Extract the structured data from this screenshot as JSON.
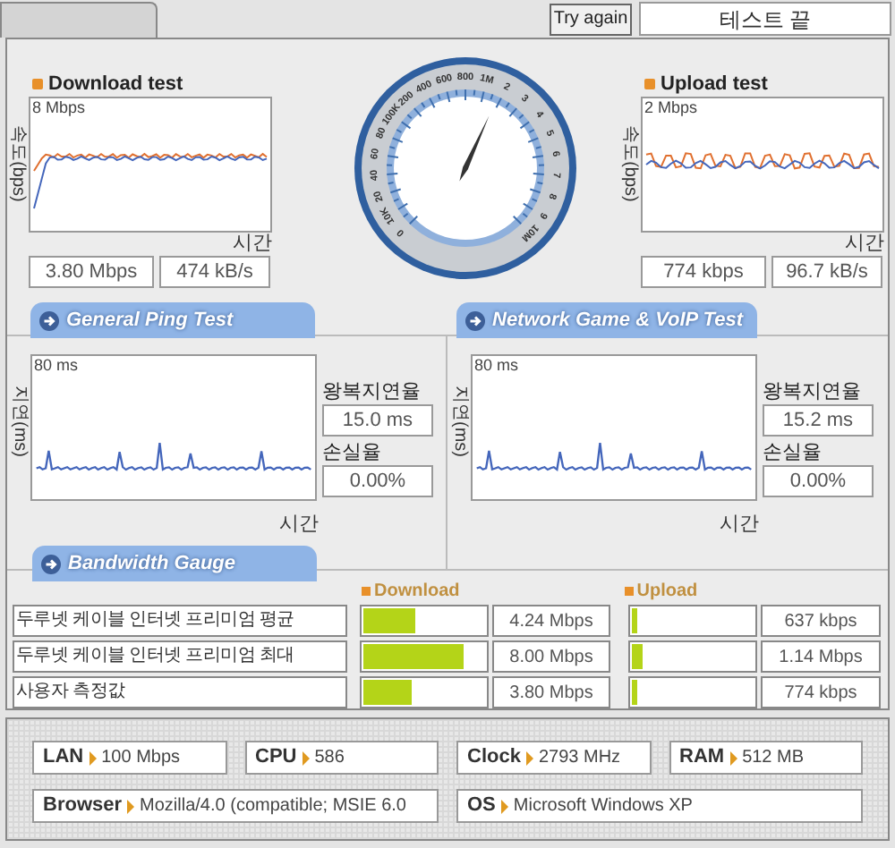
{
  "try_again_button": "Try again",
  "status_field": "테스트 끝",
  "download_test": {
    "title": "Download test",
    "scale_label": "8 Mbps",
    "ylabel": "속도(bps)",
    "xlabel": "시간",
    "rate": "3.80 Mbps",
    "throughput": "474 kB/s"
  },
  "gauge": {
    "labels": [
      "0",
      "10K",
      "20",
      "40",
      "60",
      "80",
      "100K",
      "200",
      "400",
      "600",
      "800",
      "1M",
      "2",
      "3",
      "4",
      "5",
      "6",
      "7",
      "8",
      "9",
      "10M"
    ],
    "level": 0.59
  },
  "upload_test": {
    "title": "Upload test",
    "scale_label": "2 Mbps",
    "ylabel": "속도(bps)",
    "xlabel": "시간",
    "rate": "774 kbps",
    "throughput": "96.7 kB/s"
  },
  "section_tabs": [
    "General Ping Test",
    "Network Game & VoIP Test"
  ],
  "ping_tests": [
    {
      "scale_label": "80 ms",
      "ylabel": "지연(ms)",
      "xlabel": "시간",
      "latency_label": "왕복지연율",
      "latency": "15.0 ms",
      "loss_label": "손실율",
      "loss": "0.00%"
    },
    {
      "scale_label": "80 ms",
      "ylabel": "지연(ms)",
      "xlabel": "시간",
      "latency_label": "왕복지연율",
      "latency": "15.2 ms",
      "loss_label": "손실율",
      "loss": "0.00%"
    }
  ],
  "bandwidth": {
    "tab": "Bandwidth Gauge",
    "download_header": "Download",
    "upload_header": "Upload",
    "rows": [
      {
        "label": "두루넷 케이블 인터넷 프리미엄 평균",
        "download": {
          "level": 0.43,
          "reading": "4.24 Mbps"
        },
        "upload": {
          "level": 0.04,
          "reading": "637 kbps"
        }
      },
      {
        "label": "두루넷 케이블 인터넷 프리미엄 최대",
        "download": {
          "level": 0.82,
          "reading": "8.00 Mbps"
        },
        "upload": {
          "level": 0.09,
          "reading": "1.14 Mbps"
        }
      },
      {
        "label": "사용자 측정값",
        "download": {
          "level": 0.4,
          "reading": "3.80 Mbps"
        },
        "upload": {
          "level": 0.05,
          "reading": "774 kbps"
        }
      }
    ]
  },
  "system_info": [
    {
      "label": "LAN",
      "value": "100 Mbps"
    },
    {
      "label": "CPU",
      "value": "586"
    },
    {
      "label": "Clock",
      "value": "2793 MHz"
    },
    {
      "label": "RAM",
      "value": "512 MB"
    },
    {
      "label": "Browser",
      "value": "Mozilla/4.0 (compatible; MSIE 6.0"
    },
    {
      "label": "OS",
      "value": "Microsoft Windows XP"
    }
  ]
}
